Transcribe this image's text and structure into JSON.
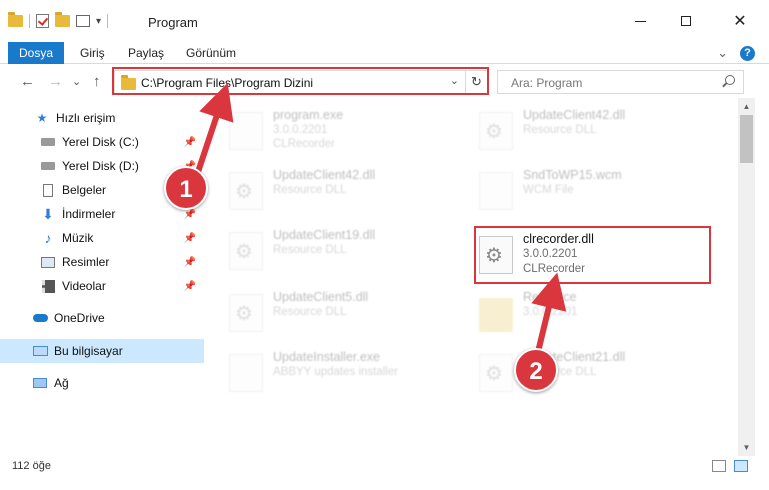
{
  "window": {
    "title": "Program",
    "minimize": "—",
    "close": "✕",
    "dropdown_arrow": "▾",
    "icons": [
      "folder-icon",
      "checkbox-icon",
      "properties-icon"
    ]
  },
  "ribbon": {
    "tabs": [
      "Dosya",
      "Giriş",
      "Paylaş",
      "Görünüm"
    ],
    "expand": "⌄",
    "help": "?"
  },
  "nav": {
    "back": "←",
    "forward": "→",
    "recent": "⌄",
    "up": "↑",
    "address": "C:\\Program Files\\Program Dizini",
    "address_dropdown": "⌄",
    "refresh": "↻",
    "search_placeholder": "Ara: Program"
  },
  "sidebar": {
    "items": [
      {
        "label": "Hızlı erişim",
        "icon": "star-icon",
        "pinned": false
      },
      {
        "label": "Yerel Disk (C:)",
        "icon": "disk-icon",
        "pinned": true
      },
      {
        "label": "Yerel Disk (D:)",
        "icon": "disk-icon",
        "pinned": true
      },
      {
        "label": "Belgeler",
        "icon": "document-icon",
        "pinned": true
      },
      {
        "label": "İndirmeler",
        "icon": "download-icon",
        "pinned": true
      },
      {
        "label": "Müzik",
        "icon": "music-icon",
        "pinned": true
      },
      {
        "label": "Resimler",
        "icon": "pictures-icon",
        "pinned": true
      },
      {
        "label": "Videolar",
        "icon": "video-icon",
        "pinned": true
      },
      {
        "label": "OneDrive",
        "icon": "cloud-icon",
        "pinned": false
      },
      {
        "label": "Bu bilgisayar",
        "icon": "computer-icon",
        "pinned": false,
        "selected": true
      },
      {
        "label": "Ağ",
        "icon": "network-icon",
        "pinned": false
      }
    ],
    "pin_glyph": "📌"
  },
  "files": [
    {
      "name": "program.exe",
      "line1": "3.0.0.2201",
      "line2": "CLRecorder",
      "faded": true
    },
    {
      "name": "UpdateClient42.dll",
      "line1": "Resource DLL",
      "line2": "",
      "faded": true
    },
    {
      "name": "UpdateClient42.dll",
      "line1": "Resource DLL",
      "line2": "",
      "faded": true
    },
    {
      "name": "SndToWP15.wcm",
      "line1": "WCM File",
      "line2": "",
      "faded": true
    },
    {
      "name": "UpdateClient19.dll",
      "line1": "Resource DLL",
      "line2": "",
      "faded": true
    },
    {
      "name": "clrecorder.dll",
      "line1": "3.0.0.2201",
      "line2": "CLRecorder",
      "faded": false
    },
    {
      "name": "UpdateClient5.dll",
      "line1": "Resource DLL",
      "line2": "",
      "faded": true
    },
    {
      "name": "Resource",
      "line1": "3.0.0.2201",
      "line2": "",
      "faded": true
    },
    {
      "name": "UpdateInstaller.exe",
      "line1": "ABBYY updates installer",
      "line2": "",
      "faded": true
    },
    {
      "name": "UpdateClient21.dll",
      "line1": "Resource DLL",
      "line2": "",
      "faded": true
    }
  ],
  "status": {
    "count": "112 öğe"
  },
  "annotations": {
    "badge1": "1",
    "badge2": "2",
    "color": "#d9363e"
  },
  "colors": {
    "accent": "#1979ca",
    "selection": "#cce8ff",
    "highlight": "#d9363e"
  }
}
